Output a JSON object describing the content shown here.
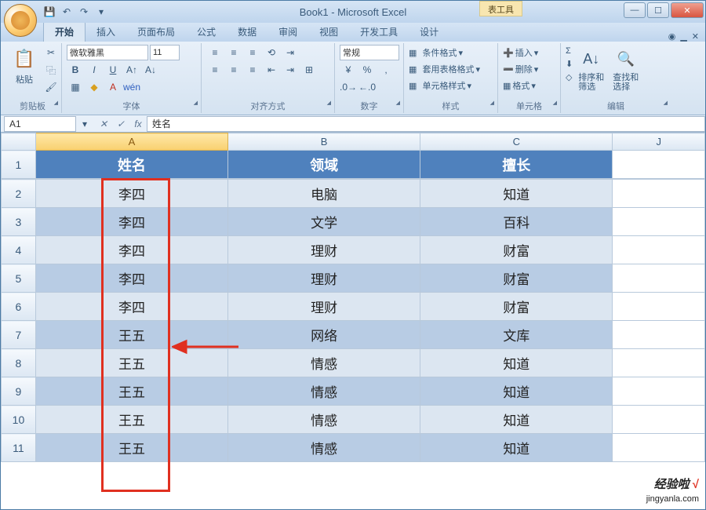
{
  "window": {
    "title": "Book1 - Microsoft Excel",
    "tool_context": "表工具"
  },
  "tabs": {
    "items": [
      "开始",
      "插入",
      "页面布局",
      "公式",
      "数据",
      "审阅",
      "视图",
      "开发工具",
      "设计"
    ],
    "active": 0
  },
  "ribbon": {
    "clipboard": {
      "label": "剪贴板",
      "paste": "粘贴"
    },
    "font": {
      "label": "字体",
      "name": "微软雅黑",
      "size": "11",
      "bold": "B",
      "italic": "I",
      "underline": "U"
    },
    "align": {
      "label": "对齐方式"
    },
    "number": {
      "label": "数字",
      "format": "常规",
      "percent": "%",
      "comma": ","
    },
    "styles": {
      "label": "样式",
      "cond": "条件格式",
      "tablefmt": "套用表格格式",
      "cellstyle": "单元格样式"
    },
    "cells": {
      "label": "单元格",
      "insert": "插入",
      "delete": "删除",
      "format": "格式"
    },
    "editing": {
      "label": "编辑",
      "sort": "排序和\n筛选",
      "find": "查找和\n选择",
      "sigma": "Σ"
    }
  },
  "formula": {
    "name_box": "A1",
    "fx": "fx",
    "value": "姓名"
  },
  "sheet": {
    "columns": [
      "A",
      "B",
      "C",
      "J"
    ],
    "headers": [
      "姓名",
      "领域",
      "擅长"
    ],
    "rows": [
      {
        "n": "2",
        "a": "李四",
        "b": "电脑",
        "c": "知道"
      },
      {
        "n": "3",
        "a": "李四",
        "b": "文学",
        "c": "百科"
      },
      {
        "n": "4",
        "a": "李四",
        "b": "理财",
        "c": "财富"
      },
      {
        "n": "5",
        "a": "李四",
        "b": "理财",
        "c": "财富"
      },
      {
        "n": "6",
        "a": "李四",
        "b": "理财",
        "c": "财富"
      },
      {
        "n": "7",
        "a": "王五",
        "b": "网络",
        "c": "文库"
      },
      {
        "n": "8",
        "a": "王五",
        "b": "情感",
        "c": "知道"
      },
      {
        "n": "9",
        "a": "王五",
        "b": "情感",
        "c": "知道"
      },
      {
        "n": "10",
        "a": "王五",
        "b": "情感",
        "c": "知道"
      },
      {
        "n": "11",
        "a": "王五",
        "b": "情感",
        "c": "知道"
      }
    ]
  },
  "watermark": {
    "brand": "经验啦",
    "check": "√",
    "url": "jingyanla.com"
  }
}
